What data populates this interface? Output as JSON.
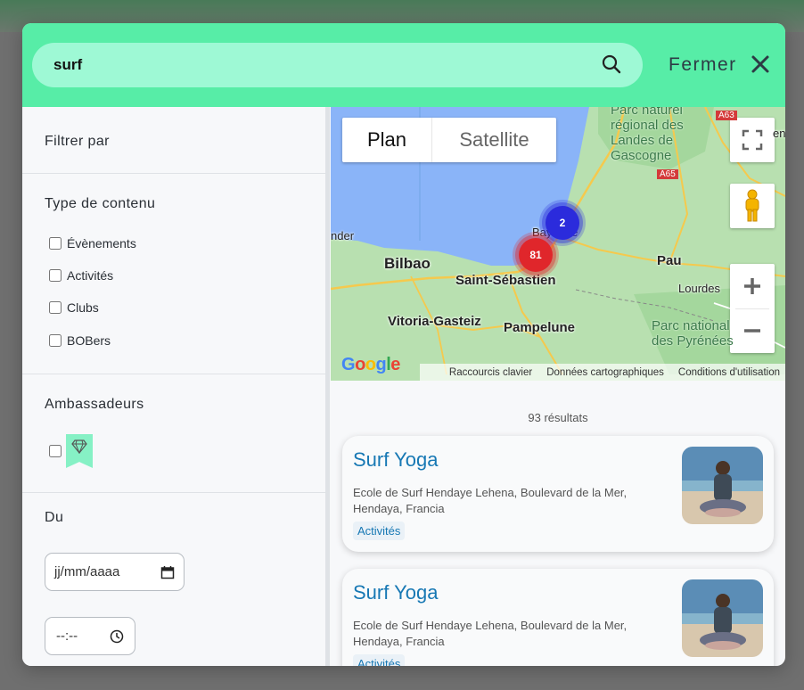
{
  "search": {
    "query": "surf",
    "icon": "search-icon"
  },
  "header": {
    "close_label": "Fermer",
    "accent": "#57eda7",
    "search_bg": "#9ef9d5"
  },
  "filters": {
    "title": "Filtrer par",
    "content_type": {
      "title": "Type de contenu",
      "options": [
        "Évènements",
        "Activités",
        "Clubs",
        "BOBers"
      ]
    },
    "ambassadors": {
      "title": "Ambassadeurs",
      "icon": "diamond-icon"
    },
    "from": {
      "title": "Du",
      "date_placeholder": "jj/mm/aaaa",
      "time_placeholder": "--:--"
    }
  },
  "map": {
    "types": [
      "Plan",
      "Satellite"
    ],
    "selected_type": "Plan",
    "clusters": [
      {
        "count": "2",
        "color": "#2b2bdc"
      },
      {
        "count": "81",
        "color": "#e0262b"
      }
    ],
    "labels": {
      "parc_landes": "Parc naturel régional des Landes de Gascogne",
      "bilbao": "Bilbao",
      "bayonne": "Bayonne",
      "saint_sebastien": "Saint-Sébastien",
      "pau": "Pau",
      "lourdes": "Lourdes",
      "vitoria": "Vitoria-Gasteiz",
      "pampelune": "Pampelune",
      "parc_pyrenees": "Parc national des Pyrénées",
      "ander": "nder",
      "road_a63": "A63",
      "road_a65": "A65",
      "en": "en"
    },
    "google": "Google",
    "footer": [
      "Raccourcis clavier",
      "Données cartographiques",
      "Conditions d'utilisation"
    ]
  },
  "results": {
    "count_label": "93 résultats",
    "items": [
      {
        "title": "Surf Yoga",
        "address": "Ecole de Surf Hendaye Lehena, Boulevard de la Mer, Hendaya, Francia",
        "tag": "Activités"
      },
      {
        "title": "Surf Yoga",
        "address": "Ecole de Surf Hendaye Lehena, Boulevard de la Mer, Hendaya, Francia",
        "tag": "Activités"
      }
    ]
  }
}
